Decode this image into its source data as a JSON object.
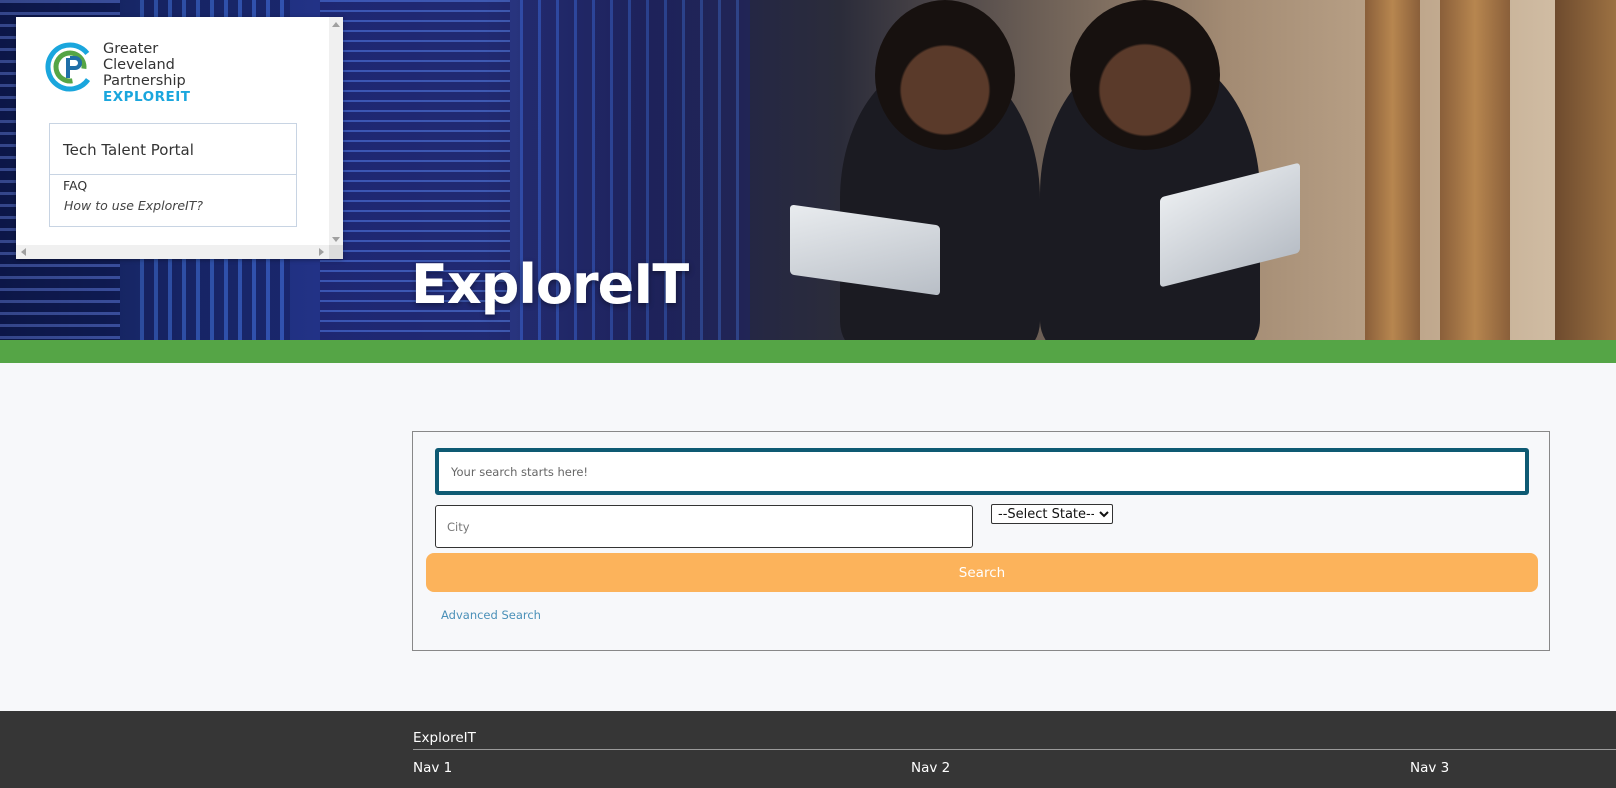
{
  "hero": {
    "title": "ExploreIT"
  },
  "brand": {
    "logo_line1": "Greater",
    "logo_line2": "Cleveland",
    "logo_line3": "Partnership",
    "logo_sub": "EXPLOREIT",
    "menu_title": "Tech Talent Portal",
    "menu_faq": "FAQ",
    "menu_howto": "How to use ExploreIT?"
  },
  "search": {
    "keyword_placeholder": "Your search starts here!",
    "city_placeholder": "City",
    "state_selected": "--Select State--",
    "button_label": "Search",
    "advanced_label": "Advanced Search"
  },
  "footer": {
    "title": "ExploreIT",
    "nav": [
      "Nav 1",
      "Nav 2",
      "Nav 3"
    ]
  },
  "colors": {
    "accent_green": "#55a546",
    "search_button": "#fcb35b",
    "input_focus_border": "#0e5a73",
    "logo_blue": "#1aa6dd",
    "footer_bg": "#363636"
  }
}
